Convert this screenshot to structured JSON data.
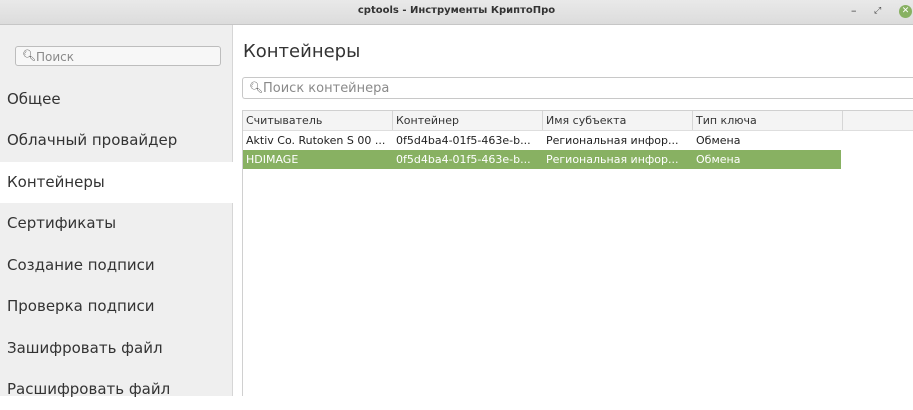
{
  "window": {
    "title": "cptools - Инструменты КриптоПро",
    "minimize_glyph": "–",
    "maximize_glyph": "⤢",
    "close_glyph": "✕"
  },
  "sidebar": {
    "search_placeholder": "Поиск",
    "items": [
      {
        "label": "Общее"
      },
      {
        "label": "Облачный провайдер"
      },
      {
        "label": "Контейнеры",
        "active": true
      },
      {
        "label": "Сертификаты"
      },
      {
        "label": "Создание подписи"
      },
      {
        "label": "Проверка подписи"
      },
      {
        "label": "Зашифровать файл"
      },
      {
        "label": "Расшифровать файл"
      }
    ]
  },
  "main": {
    "title": "Контейнеры",
    "search_placeholder": "Поиск контейнера",
    "table": {
      "columns": [
        "Считыватель",
        "Контейнер",
        "Имя субъекта",
        "Тип ключа"
      ],
      "rows": [
        [
          "Aktiv Co. Rutoken S 00 ...",
          "0f5d4ba4-01f5-463e-b...",
          "Региональная инфор...",
          "Обмена"
        ],
        [
          "HDIMAGE",
          "0f5d4ba4-01f5-463e-b...",
          "Региональная инфор...",
          "Обмена"
        ]
      ],
      "selected_row": 1
    }
  },
  "colors": {
    "accent": "#88b162",
    "sidebar_bg": "#efefef"
  },
  "icons": {
    "search": "search-icon"
  }
}
